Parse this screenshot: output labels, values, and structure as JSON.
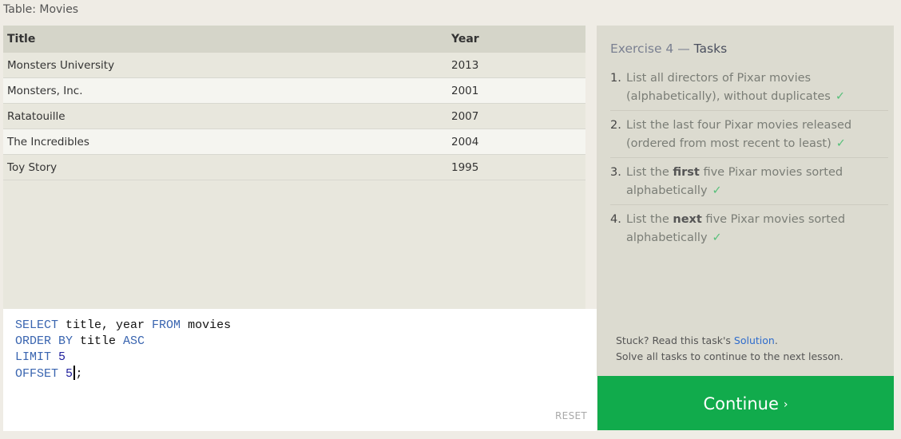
{
  "table_caption": "Table: Movies",
  "results": {
    "headers": [
      "Title",
      "Year"
    ],
    "rows": [
      [
        "Monsters University",
        "2013"
      ],
      [
        "Monsters, Inc.",
        "2001"
      ],
      [
        "Ratatouille",
        "2007"
      ],
      [
        "The Incredibles",
        "2004"
      ],
      [
        "Toy Story",
        "1995"
      ]
    ]
  },
  "editor": {
    "line1": {
      "kw1": "SELECT",
      "t1": " title, year ",
      "kw2": "FROM",
      "t2": " movies"
    },
    "line2": {
      "kw1": "ORDER BY",
      "t1": " title ",
      "kw2": "ASC"
    },
    "line3": {
      "kw1": "LIMIT",
      "n": " 5"
    },
    "line4": {
      "kw1": "OFFSET",
      "n": " 5",
      "t1": ";"
    },
    "reset_label": "RESET"
  },
  "tasks": {
    "exercise": "Exercise 4",
    "dash": " — ",
    "heading": "Tasks",
    "items": [
      {
        "num": "1.",
        "pre": "List all directors of Pixar movies (alphabetically), without duplicates",
        "bold": "",
        "post": "",
        "check": "✓"
      },
      {
        "num": "2.",
        "pre": "List the last four Pixar movies released (ordered from most recent to least)",
        "bold": "",
        "post": "",
        "check": "✓"
      },
      {
        "num": "3.",
        "pre": "List the ",
        "bold": "first",
        "post": " five Pixar movies sorted alphabetically",
        "check": "✓"
      },
      {
        "num": "4.",
        "pre": "List the ",
        "bold": "next",
        "post": " five Pixar movies sorted alphabetically",
        "check": "✓"
      }
    ],
    "stuck_pre": "Stuck? Read this task's ",
    "solution_link": "Solution",
    "stuck_post": ".",
    "solve_all": "Solve all tasks to continue to the next lesson."
  },
  "continue_label": "Continue",
  "continue_chevron": "›",
  "colors": {
    "continue": "#11ab4c",
    "check": "#57c07a",
    "keyword": "#3a65b0",
    "link": "#2f6ccc"
  }
}
